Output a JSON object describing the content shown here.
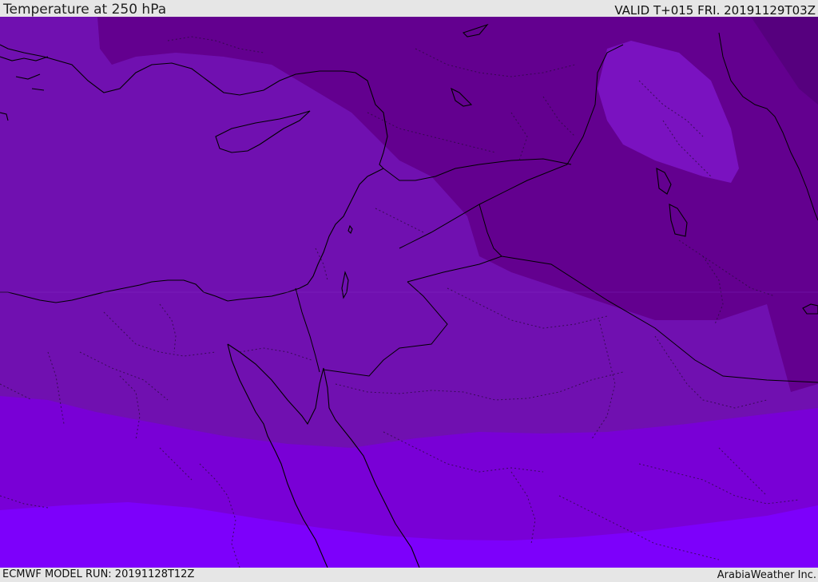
{
  "header": {
    "title": "Temperature at 250 hPa",
    "valid": "VALID T+015 FRI. 20191129T03Z"
  },
  "footer": {
    "model_run": "ECMWF MODEL RUN: 20191128T12Z",
    "credit": "ArabiaWeather Inc."
  },
  "map": {
    "variable": "temperature",
    "level": "250 hPa",
    "colors": {
      "darkest": "#56007e",
      "dark": "#63008f",
      "medium": "#7010b0",
      "light": "#7900d6",
      "lightest": "#7d00fb",
      "warm_pocket": "#7a12c0"
    }
  }
}
